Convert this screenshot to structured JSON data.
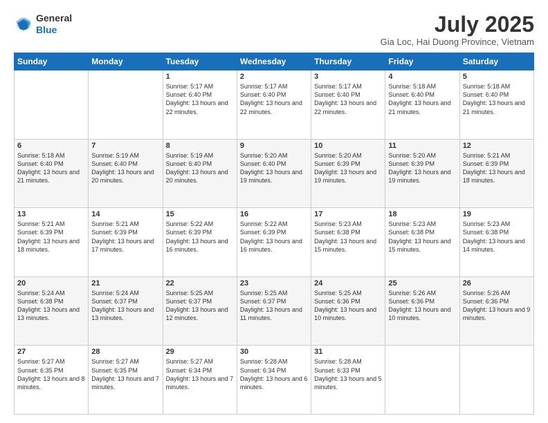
{
  "header": {
    "logo_line1": "General",
    "logo_line2": "Blue",
    "month_title": "July 2025",
    "subtitle": "Gia Loc, Hai Duong Province, Vietnam"
  },
  "days_of_week": [
    "Sunday",
    "Monday",
    "Tuesday",
    "Wednesday",
    "Thursday",
    "Friday",
    "Saturday"
  ],
  "weeks": [
    [
      {
        "day": "",
        "content": ""
      },
      {
        "day": "",
        "content": ""
      },
      {
        "day": "1",
        "content": "Sunrise: 5:17 AM\nSunset: 6:40 PM\nDaylight: 13 hours\nand 22 minutes."
      },
      {
        "day": "2",
        "content": "Sunrise: 5:17 AM\nSunset: 6:40 PM\nDaylight: 13 hours\nand 22 minutes."
      },
      {
        "day": "3",
        "content": "Sunrise: 5:17 AM\nSunset: 6:40 PM\nDaylight: 13 hours\nand 22 minutes."
      },
      {
        "day": "4",
        "content": "Sunrise: 5:18 AM\nSunset: 6:40 PM\nDaylight: 13 hours\nand 21 minutes."
      },
      {
        "day": "5",
        "content": "Sunrise: 5:18 AM\nSunset: 6:40 PM\nDaylight: 13 hours\nand 21 minutes."
      }
    ],
    [
      {
        "day": "6",
        "content": "Sunrise: 5:18 AM\nSunset: 6:40 PM\nDaylight: 13 hours\nand 21 minutes."
      },
      {
        "day": "7",
        "content": "Sunrise: 5:19 AM\nSunset: 6:40 PM\nDaylight: 13 hours\nand 20 minutes."
      },
      {
        "day": "8",
        "content": "Sunrise: 5:19 AM\nSunset: 6:40 PM\nDaylight: 13 hours\nand 20 minutes."
      },
      {
        "day": "9",
        "content": "Sunrise: 5:20 AM\nSunset: 6:40 PM\nDaylight: 13 hours\nand 19 minutes."
      },
      {
        "day": "10",
        "content": "Sunrise: 5:20 AM\nSunset: 6:39 PM\nDaylight: 13 hours\nand 19 minutes."
      },
      {
        "day": "11",
        "content": "Sunrise: 5:20 AM\nSunset: 6:39 PM\nDaylight: 13 hours\nand 19 minutes."
      },
      {
        "day": "12",
        "content": "Sunrise: 5:21 AM\nSunset: 6:39 PM\nDaylight: 13 hours\nand 18 minutes."
      }
    ],
    [
      {
        "day": "13",
        "content": "Sunrise: 5:21 AM\nSunset: 6:39 PM\nDaylight: 13 hours\nand 18 minutes."
      },
      {
        "day": "14",
        "content": "Sunrise: 5:21 AM\nSunset: 6:39 PM\nDaylight: 13 hours\nand 17 minutes."
      },
      {
        "day": "15",
        "content": "Sunrise: 5:22 AM\nSunset: 6:39 PM\nDaylight: 13 hours\nand 16 minutes."
      },
      {
        "day": "16",
        "content": "Sunrise: 5:22 AM\nSunset: 6:39 PM\nDaylight: 13 hours\nand 16 minutes."
      },
      {
        "day": "17",
        "content": "Sunrise: 5:23 AM\nSunset: 6:38 PM\nDaylight: 13 hours\nand 15 minutes."
      },
      {
        "day": "18",
        "content": "Sunrise: 5:23 AM\nSunset: 6:38 PM\nDaylight: 13 hours\nand 15 minutes."
      },
      {
        "day": "19",
        "content": "Sunrise: 5:23 AM\nSunset: 6:38 PM\nDaylight: 13 hours\nand 14 minutes."
      }
    ],
    [
      {
        "day": "20",
        "content": "Sunrise: 5:24 AM\nSunset: 6:38 PM\nDaylight: 13 hours\nand 13 minutes."
      },
      {
        "day": "21",
        "content": "Sunrise: 5:24 AM\nSunset: 6:37 PM\nDaylight: 13 hours\nand 13 minutes."
      },
      {
        "day": "22",
        "content": "Sunrise: 5:25 AM\nSunset: 6:37 PM\nDaylight: 13 hours\nand 12 minutes."
      },
      {
        "day": "23",
        "content": "Sunrise: 5:25 AM\nSunset: 6:37 PM\nDaylight: 13 hours\nand 11 minutes."
      },
      {
        "day": "24",
        "content": "Sunrise: 5:25 AM\nSunset: 6:36 PM\nDaylight: 13 hours\nand 10 minutes."
      },
      {
        "day": "25",
        "content": "Sunrise: 5:26 AM\nSunset: 6:36 PM\nDaylight: 13 hours\nand 10 minutes."
      },
      {
        "day": "26",
        "content": "Sunrise: 5:26 AM\nSunset: 6:36 PM\nDaylight: 13 hours\nand 9 minutes."
      }
    ],
    [
      {
        "day": "27",
        "content": "Sunrise: 5:27 AM\nSunset: 6:35 PM\nDaylight: 13 hours\nand 8 minutes."
      },
      {
        "day": "28",
        "content": "Sunrise: 5:27 AM\nSunset: 6:35 PM\nDaylight: 13 hours\nand 7 minutes."
      },
      {
        "day": "29",
        "content": "Sunrise: 5:27 AM\nSunset: 6:34 PM\nDaylight: 13 hours\nand 7 minutes."
      },
      {
        "day": "30",
        "content": "Sunrise: 5:28 AM\nSunset: 6:34 PM\nDaylight: 13 hours\nand 6 minutes."
      },
      {
        "day": "31",
        "content": "Sunrise: 5:28 AM\nSunset: 6:33 PM\nDaylight: 13 hours\nand 5 minutes."
      },
      {
        "day": "",
        "content": ""
      },
      {
        "day": "",
        "content": ""
      }
    ]
  ]
}
